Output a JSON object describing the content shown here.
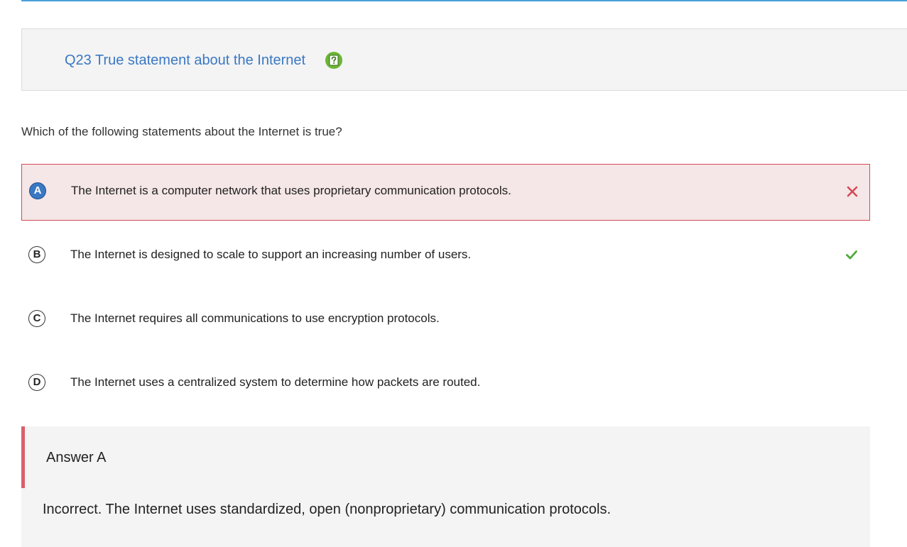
{
  "question": {
    "title": "Q23 True statement about the Internet",
    "prompt": "Which of the following statements about the Internet is true?"
  },
  "options": [
    {
      "letter": "A",
      "text": "The Internet is a computer network that uses proprietary communication protocols.",
      "selected": true,
      "mark": "x-icon"
    },
    {
      "letter": "B",
      "text": "The Internet is designed to scale to support an increasing number of users.",
      "selected": false,
      "mark": "check-icon"
    },
    {
      "letter": "C",
      "text": "The Internet requires all communications to use encryption protocols.",
      "selected": false,
      "mark": ""
    },
    {
      "letter": "D",
      "text": "The Internet uses a centralized system to determine how packets are routed.",
      "selected": false,
      "mark": ""
    }
  ],
  "answer": {
    "label": "Answer A",
    "explanation": "Incorrect. The Internet uses standardized, open (nonproprietary) communication protocols."
  },
  "colors": {
    "accent_blue": "#3a78c3",
    "wrong_red": "#d24a57",
    "correct_green": "#4caa3a",
    "help_green": "#6bb536"
  },
  "icons": {
    "help": "help-icon",
    "wrong": "x-icon",
    "correct": "check-icon"
  }
}
